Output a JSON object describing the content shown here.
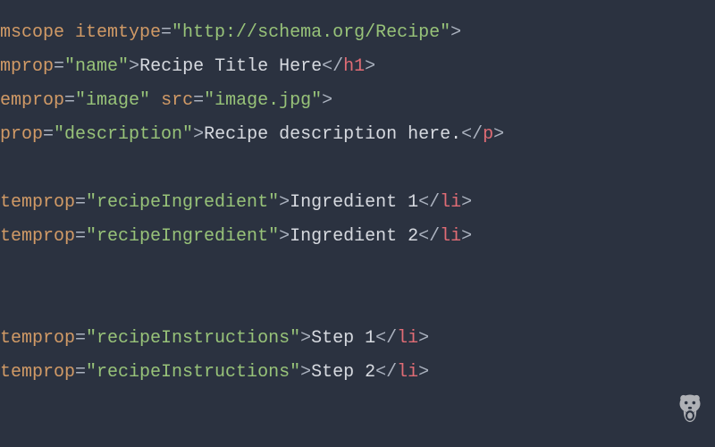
{
  "lines": [
    {
      "segments": [
        {
          "t": "mscope ",
          "c": "attr-name"
        },
        {
          "t": "itemtype",
          "c": "attr-name"
        },
        {
          "t": "=",
          "c": "operator"
        },
        {
          "t": "\"http://schema.org/Recipe\"",
          "c": "string"
        },
        {
          "t": ">",
          "c": "tag-bracket"
        }
      ]
    },
    {
      "segments": [
        {
          "t": "mprop",
          "c": "attr-name"
        },
        {
          "t": "=",
          "c": "operator"
        },
        {
          "t": "\"name\"",
          "c": "string"
        },
        {
          "t": ">",
          "c": "tag-bracket"
        },
        {
          "t": "Recipe Title Here",
          "c": "text"
        },
        {
          "t": "</",
          "c": "tag-bracket"
        },
        {
          "t": "h1",
          "c": "tag-name"
        },
        {
          "t": ">",
          "c": "tag-bracket"
        }
      ]
    },
    {
      "segments": [
        {
          "t": "emprop",
          "c": "attr-name"
        },
        {
          "t": "=",
          "c": "operator"
        },
        {
          "t": "\"image\"",
          "c": "string"
        },
        {
          "t": " ",
          "c": "text"
        },
        {
          "t": "src",
          "c": "attr-name"
        },
        {
          "t": "=",
          "c": "operator"
        },
        {
          "t": "\"image.jpg\"",
          "c": "string"
        },
        {
          "t": ">",
          "c": "tag-bracket"
        }
      ]
    },
    {
      "segments": [
        {
          "t": "prop",
          "c": "attr-name"
        },
        {
          "t": "=",
          "c": "operator"
        },
        {
          "t": "\"description\"",
          "c": "string"
        },
        {
          "t": ">",
          "c": "tag-bracket"
        },
        {
          "t": "Recipe description here.",
          "c": "text"
        },
        {
          "t": "</",
          "c": "tag-bracket"
        },
        {
          "t": "p",
          "c": "tag-name"
        },
        {
          "t": ">",
          "c": "tag-bracket"
        }
      ]
    },
    {
      "segments": []
    },
    {
      "segments": [
        {
          "t": "temprop",
          "c": "attr-name"
        },
        {
          "t": "=",
          "c": "operator"
        },
        {
          "t": "\"recipeIngredient\"",
          "c": "string"
        },
        {
          "t": ">",
          "c": "tag-bracket"
        },
        {
          "t": "Ingredient 1",
          "c": "text"
        },
        {
          "t": "</",
          "c": "tag-bracket"
        },
        {
          "t": "li",
          "c": "tag-name"
        },
        {
          "t": ">",
          "c": "tag-bracket"
        }
      ]
    },
    {
      "segments": [
        {
          "t": "temprop",
          "c": "attr-name"
        },
        {
          "t": "=",
          "c": "operator"
        },
        {
          "t": "\"recipeIngredient\"",
          "c": "string"
        },
        {
          "t": ">",
          "c": "tag-bracket"
        },
        {
          "t": "Ingredient 2",
          "c": "text"
        },
        {
          "t": "</",
          "c": "tag-bracket"
        },
        {
          "t": "li",
          "c": "tag-name"
        },
        {
          "t": ">",
          "c": "tag-bracket"
        }
      ]
    },
    {
      "segments": []
    },
    {
      "segments": []
    },
    {
      "segments": [
        {
          "t": "temprop",
          "c": "attr-name"
        },
        {
          "t": "=",
          "c": "operator"
        },
        {
          "t": "\"recipeInstructions\"",
          "c": "string"
        },
        {
          "t": ">",
          "c": "tag-bracket"
        },
        {
          "t": "Step 1",
          "c": "text"
        },
        {
          "t": "</",
          "c": "tag-bracket"
        },
        {
          "t": "li",
          "c": "tag-name"
        },
        {
          "t": ">",
          "c": "tag-bracket"
        }
      ]
    },
    {
      "segments": [
        {
          "t": "temprop",
          "c": "attr-name"
        },
        {
          "t": "=",
          "c": "operator"
        },
        {
          "t": "\"recipeInstructions\"",
          "c": "string"
        },
        {
          "t": ">",
          "c": "tag-bracket"
        },
        {
          "t": "Step 2",
          "c": "text"
        },
        {
          "t": "</",
          "c": "tag-bracket"
        },
        {
          "t": "li",
          "c": "tag-name"
        },
        {
          "t": ">",
          "c": "tag-bracket"
        }
      ]
    }
  ]
}
